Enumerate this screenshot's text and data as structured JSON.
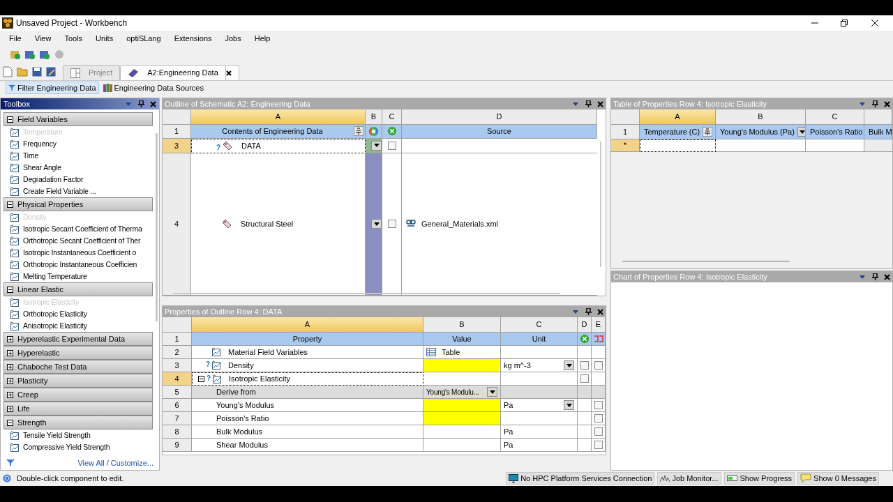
{
  "window": {
    "title": "Unsaved Project - Workbench"
  },
  "menu": [
    "File",
    "View",
    "Tools",
    "Units",
    "optiSLang",
    "Extensions",
    "Jobs",
    "Help"
  ],
  "tabs": [
    {
      "label": "Project",
      "selected": false
    },
    {
      "label": "A2:Engineering Data",
      "selected": true,
      "closable": true
    }
  ],
  "filter_bar": [
    {
      "label": "Filter Engineering Data",
      "selected": true,
      "kind": "filter"
    },
    {
      "label": "Engineering Data Sources",
      "selected": false,
      "kind": "books"
    }
  ],
  "toolbox": {
    "title": "Toolbox",
    "groups": [
      {
        "label": "Field Variables",
        "expanded": true,
        "items": [
          {
            "label": "Temperature",
            "disabled": true
          },
          {
            "label": "Frequency",
            "disabled": false
          },
          {
            "label": "Time",
            "disabled": false
          },
          {
            "label": "Shear Angle",
            "disabled": false
          },
          {
            "label": "Degradation Factor",
            "disabled": false
          },
          {
            "label": "Create Field Variable ...",
            "disabled": false
          }
        ]
      },
      {
        "label": "Physical Properties",
        "expanded": true,
        "items": [
          {
            "label": "Density",
            "disabled": true
          },
          {
            "label": "Isotropic Secant Coefficient of Therma",
            "disabled": false
          },
          {
            "label": "Orthotropic Secant Coefficient of Ther",
            "disabled": false
          },
          {
            "label": "Isotropic Instantaneous Coefficient o",
            "disabled": false
          },
          {
            "label": "Orthotropic Instantaneous Coefficien",
            "disabled": false
          },
          {
            "label": "Melting Temperature",
            "disabled": false
          }
        ]
      },
      {
        "label": "Linear Elastic",
        "expanded": true,
        "items": [
          {
            "label": "Isotropic Elasticity",
            "disabled": true
          },
          {
            "label": "Orthotropic Elasticity",
            "disabled": false
          },
          {
            "label": "Anisotropic Elasticity",
            "disabled": false
          }
        ]
      },
      {
        "label": "Hyperelastic Experimental Data",
        "expanded": false
      },
      {
        "label": "Hyperelastic",
        "expanded": false
      },
      {
        "label": "Chaboche Test Data",
        "expanded": false
      },
      {
        "label": "Plasticity",
        "expanded": false
      },
      {
        "label": "Creep",
        "expanded": false
      },
      {
        "label": "Life",
        "expanded": false
      },
      {
        "label": "Strength",
        "expanded": true,
        "items": [
          {
            "label": "Tensile Yield Strength",
            "disabled": false
          },
          {
            "label": "Compressive Yield Strength",
            "disabled": false
          }
        ]
      }
    ],
    "footer_link": "View All / Customize..."
  },
  "outline": {
    "title": "Outline of Schematic A2: Engineering Data",
    "columns": [
      "A",
      "B",
      "C",
      "D"
    ],
    "header_number": "1",
    "header_contents": "Contents of Engineering Data",
    "header_source": "Source",
    "rows": [
      {
        "number": "3",
        "name": "DATA",
        "selected": true,
        "status_mark": "?",
        "checked": false
      },
      {
        "number": "4",
        "name": "Structural Steel",
        "source": "General_Materials.xml",
        "selected": false,
        "checked": false
      }
    ]
  },
  "properties": {
    "title": "Properties of Outline Row 4: DATA",
    "columns": [
      "A",
      "B",
      "C",
      "D",
      "E"
    ],
    "header_number": "1",
    "headers": [
      "Property",
      "Value",
      "Unit"
    ],
    "rows": [
      {
        "number": "2",
        "kind": "property",
        "label": "Material Field Variables",
        "value": "Table"
      },
      {
        "number": "3",
        "kind": "property",
        "label": "Density",
        "unit": "kg m^-3",
        "status_mark": "?",
        "required": true,
        "unit_dropdown": true,
        "d_checked": false,
        "e_checked": false
      },
      {
        "number": "4",
        "kind": "property",
        "label": "Isotropic Elasticity",
        "status_mark": "?",
        "selected": true,
        "expanded": true,
        "d_checked": false
      },
      {
        "number": "5",
        "kind": "option",
        "label": "Derive from",
        "value": "Young's Modulu..."
      },
      {
        "number": "6",
        "kind": "parameter",
        "label": "Young's Modulus",
        "unit": "Pa",
        "required": true,
        "unit_dropdown": true,
        "e_checked": false
      },
      {
        "number": "7",
        "kind": "parameter",
        "label": "Poisson's Ratio",
        "required": true,
        "e_checked": false
      },
      {
        "number": "8",
        "kind": "parameter",
        "label": "Bulk Modulus",
        "unit": "Pa",
        "e_checked": false
      },
      {
        "number": "9",
        "kind": "parameter",
        "label": "Shear Modulus",
        "unit": "Pa",
        "e_checked": false
      }
    ]
  },
  "table": {
    "title": "Table of Properties Row 4: Isotropic Elasticity",
    "columns": [
      "A",
      "B",
      "C"
    ],
    "header_number": "1",
    "headers": [
      "Temperature (C)",
      "Young's Modulus (Pa)",
      "Poisson's Ratio",
      "Bulk M"
    ],
    "new_row": "*"
  },
  "chart": {
    "title": "Chart of Properties Row 4: Isotropic Elasticity"
  },
  "status": {
    "text": "Double-click component to edit.",
    "buttons": [
      {
        "label": "No HPC Platform Services Connection",
        "kind": "monitor"
      },
      {
        "label": "Job Monitor...",
        "kind": "wave"
      },
      {
        "label": "Show Progress",
        "kind": "battery"
      },
      {
        "label": "Show 0 Messages",
        "kind": "note"
      }
    ]
  }
}
